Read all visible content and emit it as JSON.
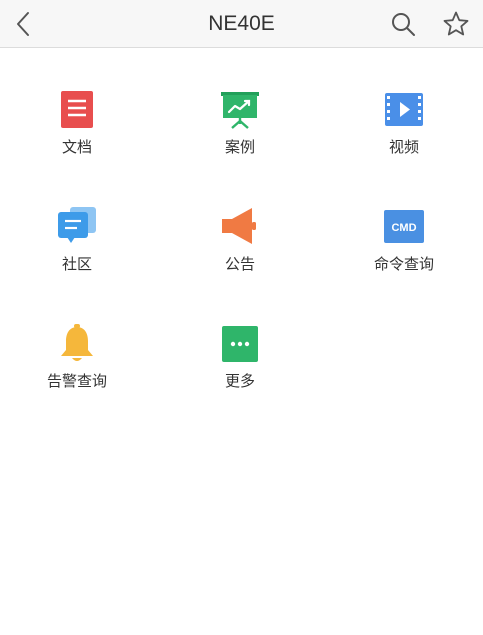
{
  "header": {
    "title": "NE40E"
  },
  "grid": {
    "items": [
      {
        "label": "文档",
        "icon": "document-icon",
        "color": "#e84e4e"
      },
      {
        "label": "案例",
        "icon": "presentation-chart-icon",
        "color": "#2fb56a"
      },
      {
        "label": "视频",
        "icon": "video-icon",
        "color": "#4a8fe8"
      },
      {
        "label": "社区",
        "icon": "chat-bubbles-icon",
        "color": "#3d9be9"
      },
      {
        "label": "公告",
        "icon": "megaphone-icon",
        "color": "#f07a43"
      },
      {
        "label": "命令查询",
        "icon": "cmd-icon",
        "color": "#4a90e2",
        "icon_text": "CMD"
      },
      {
        "label": "告警查询",
        "icon": "bell-icon",
        "color": "#f5b73b"
      },
      {
        "label": "更多",
        "icon": "more-icon",
        "color": "#2fb56a"
      }
    ]
  }
}
